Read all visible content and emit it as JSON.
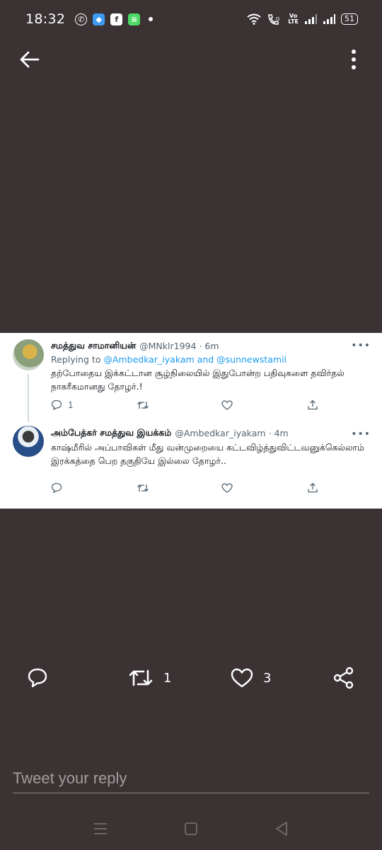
{
  "status_bar": {
    "time": "18:32",
    "apps": [
      {
        "icon": "whatsapp-icon",
        "glyph": "✆",
        "color": "#ffffff"
      },
      {
        "icon": "app-shield-icon",
        "glyph": "◆",
        "color": "#3e9bf2"
      },
      {
        "icon": "facebook-icon",
        "glyph": "f",
        "color": "#ffffff"
      },
      {
        "icon": "app-green-icon",
        "glyph": "≡",
        "color": "#4cd964"
      }
    ],
    "volte": [
      "Vo",
      "LTE"
    ],
    "battery": "51"
  },
  "card": {
    "tweets": [
      {
        "name": "சமத்துவ சாமானியன்",
        "handle": "@MNklr1994",
        "time": "6m",
        "replying_label": "Replying to ",
        "replying_to": "@Ambedkar_iyakam and @sunnewstamil",
        "text": "தற்போதைய இக்கட்டான சூழ்நிலையில் இதுபோன்ற பதிவுகளை தவிர்தல் நாகரீகமானது தோழர்.!",
        "reply_count": "1",
        "retweet_count": "",
        "like_count": ""
      },
      {
        "name": "அம்பேத்கர் சமத்துவ இயக்கம்",
        "handle": "@Ambedkar_iyakam",
        "time": "4m",
        "text": "காஷ்மீரில் அப்பாவிகள் மீது வன்முறையை கட்டவிழ்த்துவிட்டவனுக்கெல்லாம் இரக்கத்தை பெற தகுதியே இல்லை தோழர்..",
        "reply_count": "",
        "retweet_count": "",
        "like_count": ""
      }
    ],
    "menu_glyph": "•••"
  },
  "actions": {
    "retweet_count": "1",
    "like_count": "3"
  },
  "reply": {
    "placeholder": "Tweet your reply"
  },
  "colors": {
    "background": "#3a3233",
    "card": "#ffffff",
    "link": "#1d9bf0",
    "muted": "#536471"
  }
}
